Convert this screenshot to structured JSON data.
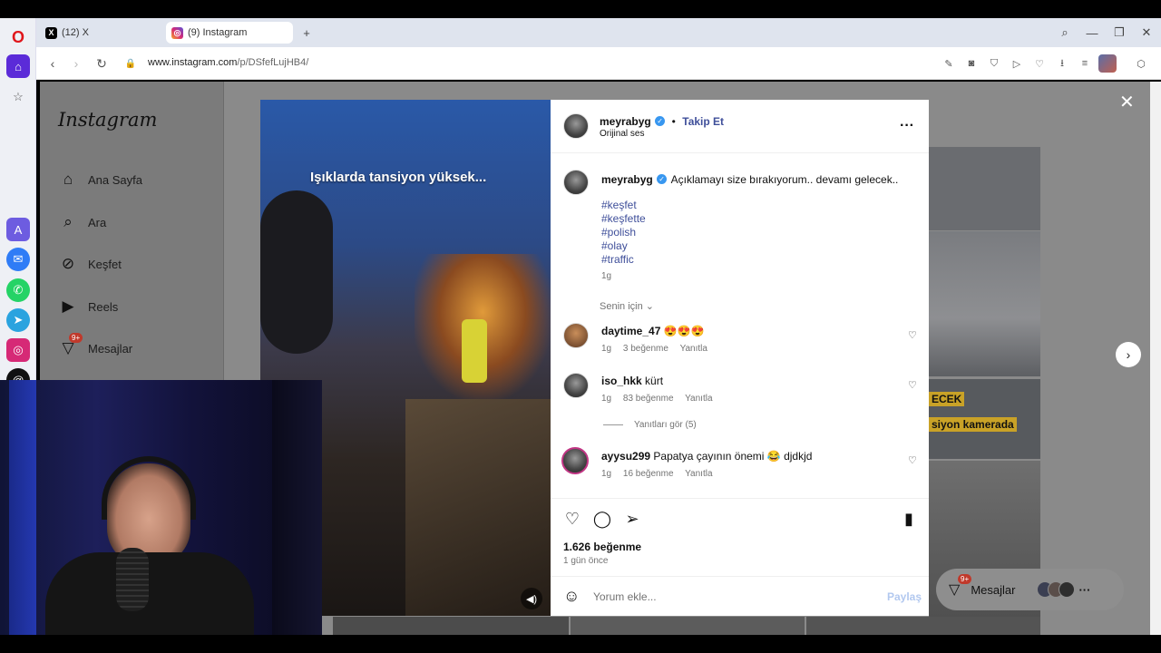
{
  "browser": {
    "tabs": [
      {
        "label": "(12) X",
        "icon": "x-icon"
      },
      {
        "label": "(9) Instagram",
        "icon": "instagram-icon"
      }
    ],
    "url_prefix": "www.instagram.com",
    "url_path": "/p/DSfefLujHB4/"
  },
  "ig_nav": {
    "logo": "Instagram",
    "items": [
      {
        "label": "Ana Sayfa",
        "icon": "home-icon"
      },
      {
        "label": "Ara",
        "icon": "search-icon"
      },
      {
        "label": "Keşfet",
        "icon": "explore-icon"
      },
      {
        "label": "Reels",
        "icon": "reels-icon"
      },
      {
        "label": "Mesajlar",
        "icon": "messages-icon",
        "badge": "9+"
      }
    ]
  },
  "video": {
    "caption": "Işıklarda tansiyon yüksek...",
    "mute_icon": "volume-icon"
  },
  "post": {
    "username": "meyrabyg",
    "follow_label": "Takip Et",
    "dot": "•",
    "audio": "Orijinal ses",
    "caption_user": "meyrabyg",
    "caption_text": "Açıklamayı size bırakıyorum.. devamı gelecek..",
    "hashtags": [
      "#keşfet",
      "#keşfette",
      "#polish",
      "#olay",
      "#traffic"
    ],
    "caption_time": "1g",
    "filter_label": "Senin için",
    "comments": [
      {
        "user": "daytime_47",
        "text": "😍😍😍",
        "time": "1g",
        "likes": "3 beğenme",
        "reply": "Yanıtla"
      },
      {
        "user": "iso_hkk",
        "text": "kürt",
        "time": "1g",
        "likes": "83 beğenme",
        "reply": "Yanıtla",
        "view_replies": "Yanıtları gör (5)"
      },
      {
        "user": "ayysu299",
        "text": "Papatya çayının önemi 😂 djdkjd",
        "time": "1g",
        "likes": "16 beğenme",
        "reply": "Yanıtla"
      }
    ],
    "likes_count": "1.626 beğenme",
    "posted_ago": "1 gün önce",
    "comment_placeholder": "Yorum ekle...",
    "share_label": "Paylaş"
  },
  "overlay_right": {
    "thumb_text_1": "ECEK",
    "thumb_text_2": "siyon kamerada",
    "messages_label": "Mesajlar",
    "messages_badge": "9+",
    "more": "···"
  }
}
